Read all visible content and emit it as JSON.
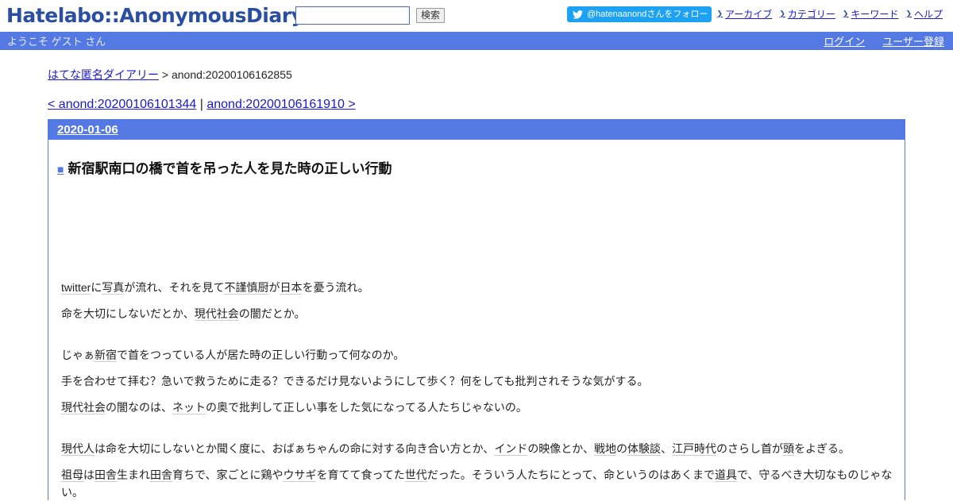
{
  "header": {
    "logo": "Hatelabo::AnonymousDiary",
    "search": {
      "value": "",
      "placeholder": "",
      "button_label": "検索"
    },
    "follow_label": "@hatenaanondさんをフォロー",
    "nav": [
      "アーカイブ",
      "カテゴリー",
      "キーワード",
      "ヘルプ"
    ]
  },
  "bluebar": {
    "welcome": "ようこそ ゲスト さん",
    "login": "ログイン",
    "register": "ユーザー登録"
  },
  "breadcrumb": {
    "home": "はてな匿名ダイアリー",
    "separator": " > ",
    "current": "anond:20200106162855"
  },
  "pager": {
    "prev": "< anond:20200106101344",
    "separator": " | ",
    "next": "anond:20200106161910 >"
  },
  "day": {
    "date": "2020-01-06"
  },
  "entry": {
    "mark": "■",
    "title": "新宿駅南口の橋で首を吊った人を見た時の正しい行動",
    "paragraphs": [
      [
        [
          "twitter",
          true
        ],
        [
          "に",
          false
        ],
        [
          "写真",
          true
        ],
        [
          "が流れ、それを見て",
          false
        ],
        [
          "不謹慎厨",
          true
        ],
        [
          "が",
          false
        ],
        [
          "日本",
          true
        ],
        [
          "を憂う流れ。",
          false
        ]
      ],
      [
        [
          "命を大切にしないだとか、",
          false
        ],
        [
          "現代社会",
          true
        ],
        [
          "の闇だとか。",
          false
        ]
      ],
      [
        [
          "じゃぁ",
          false
        ],
        [
          "新宿",
          true
        ],
        [
          "で首をつっている人が居た時の正しい行動って何なのか。",
          false
        ]
      ],
      [
        [
          "手を合わせて拝む？急いで救うために走る？できるだけ見ないようにして歩く？何をしても批判されそうな気がする。",
          false
        ]
      ],
      [
        [
          "現代社会",
          true
        ],
        [
          "の闇なのは、",
          false
        ],
        [
          "ネット",
          true
        ],
        [
          "の奥で批判して正しい事をした気になってる人たちじゃないの。",
          false
        ]
      ],
      [
        [
          "現代人",
          true
        ],
        [
          "は命を大切にしないとか聞く度に、おばぁちゃんの命に対する向き合い方とか、",
          false
        ],
        [
          "インド",
          true
        ],
        [
          "の映像とか、",
          false
        ],
        [
          "戦地",
          true
        ],
        [
          "の",
          false
        ],
        [
          "体験談",
          true
        ],
        [
          "、",
          false
        ],
        [
          "江戸時代",
          true
        ],
        [
          "のさらし首が",
          false
        ],
        [
          "頭",
          true
        ],
        [
          "をよぎる。",
          false
        ]
      ],
      [
        [
          "祖母",
          true
        ],
        [
          "は",
          false
        ],
        [
          "田舎",
          true
        ],
        [
          "生まれ",
          false
        ],
        [
          "田舎",
          true
        ],
        [
          "育ちで、家ごとに鶏や",
          false
        ],
        [
          "ウサギ",
          true
        ],
        [
          "を育てて食ってた",
          false
        ],
        [
          "世代",
          true
        ],
        [
          "だった。そういう人たちにとって、命というのはあくまで",
          false
        ],
        [
          "道具",
          true
        ],
        [
          "で、守るべき大切なものじゃない。",
          false
        ]
      ]
    ]
  }
}
